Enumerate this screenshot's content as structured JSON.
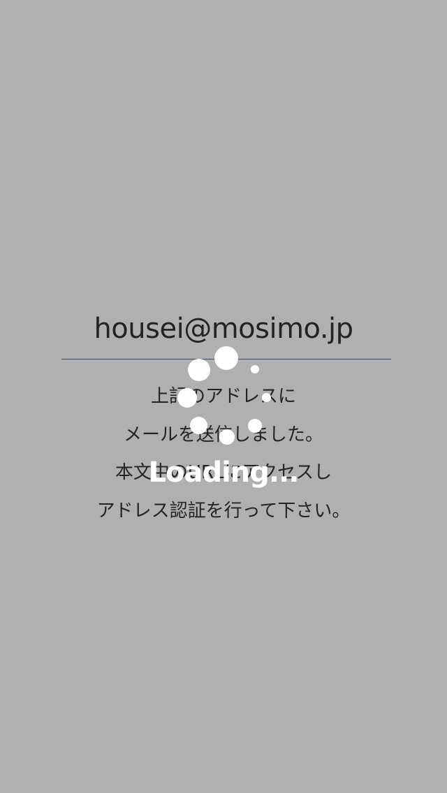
{
  "screen": {
    "email": "housei@mosimo.jp",
    "message_lines": [
      "上記のアドレスに",
      "メールを送信しました。",
      "本文中のURLにアクセスし",
      "アドレス認証を行って下さい。"
    ]
  },
  "overlay": {
    "loading_label": "Loading...",
    "icon": "loading-spinner-icon"
  },
  "colors": {
    "overlay": "rgba(0,0,0,0.31)",
    "divider": "#4a6fa5",
    "text": "#333333",
    "spinner": "#ffffff"
  }
}
